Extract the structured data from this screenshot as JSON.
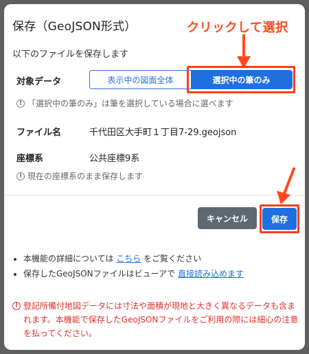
{
  "dialog": {
    "title": "保存（GeoJSON形式）",
    "intro": "以下のファイルを保存します"
  },
  "annotation": {
    "callout": "クリックして選択",
    "highlight_color": "#ff3d17"
  },
  "target": {
    "label": "対象データ",
    "options": [
      "表示中の図面全体",
      "選択中の筆のみ"
    ],
    "selected": "選択中の筆のみ",
    "hint": "「選択中の筆のみ」は筆を選択している場合に選べます"
  },
  "file": {
    "label": "ファイル名",
    "value": "千代田区大手町１丁目7-29.geojson"
  },
  "coord": {
    "label": "座標系",
    "value": "公共座標9系",
    "hint": "現在の座標系のまま保存します"
  },
  "buttons": {
    "cancel": "キャンセル",
    "save": "保存"
  },
  "notes": {
    "line1_pre": "本機能の詳細については",
    "line1_link": "こちら",
    "line1_post": "をご覧ください",
    "line2_pre": "保存したGeoJSONファイルはビューアで",
    "line2_link": "直接読み込めます"
  },
  "warning": {
    "text": "登記所備付地図データには寸法や面積が現地と大きく異なるデータも含まれます。本機能で保存したGeoJSONファイルをご利用の際には細心の注意を払ってください。"
  },
  "icons": {
    "info": "!",
    "accent": "#1f6fe0",
    "warning_color": "#e0302a"
  }
}
